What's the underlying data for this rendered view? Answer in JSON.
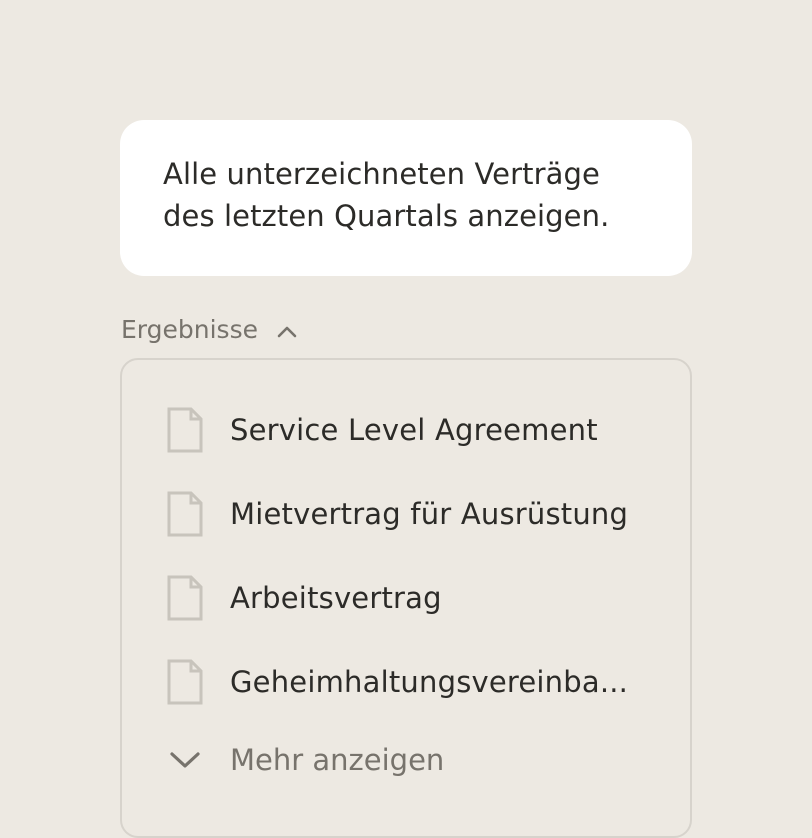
{
  "prompt": {
    "line1": "Alle unterzeichneten Verträge",
    "line2": "des letzten Quartals anzeigen."
  },
  "results": {
    "label": "Ergebnisse",
    "toggle_icon": "chevron-up-icon",
    "items": [
      {
        "title": "Service Level Agreement",
        "icon": "document-icon"
      },
      {
        "title": "Mietvertrag für Ausrüstung",
        "icon": "document-icon"
      },
      {
        "title": "Arbeitsvertrag",
        "icon": "document-icon"
      },
      {
        "title": "Geheimhaltungsvereinba...",
        "icon": "document-icon"
      }
    ],
    "show_more": {
      "label": "Mehr anzeigen",
      "icon": "chevron-down-icon"
    }
  },
  "colors": {
    "background": "#ede9e2",
    "bubble": "#ffffff",
    "text_primary": "#2c2b28",
    "text_muted": "#77736c",
    "icon": "#c8c4bc",
    "panel_border": "#d7d3cc"
  }
}
